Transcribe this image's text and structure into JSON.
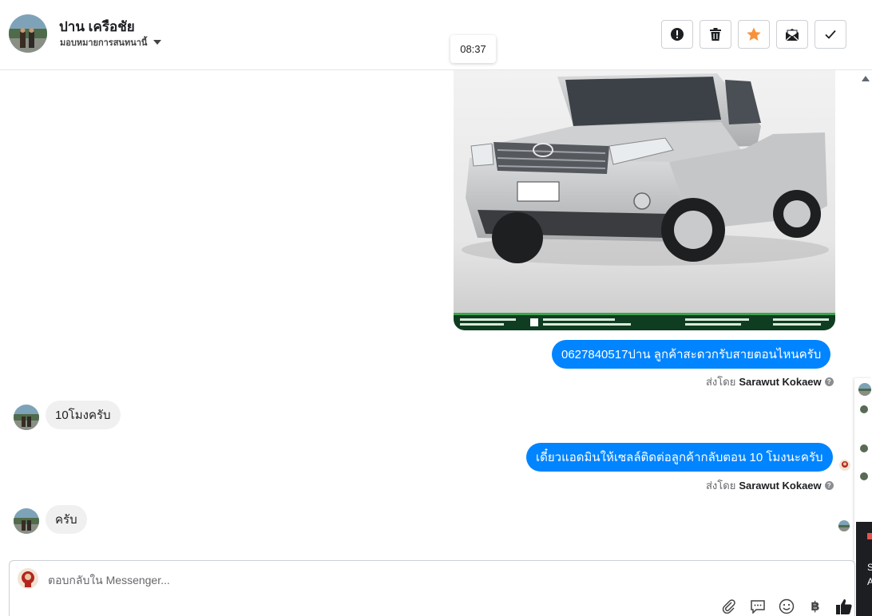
{
  "header": {
    "contact_name": "ปาน เครือชัย",
    "assign_label": "มอบหมายการสนทนานี้",
    "toolbar": {
      "spam": "alert-icon",
      "delete": "trash-icon",
      "star": "star-icon",
      "mark_unread": "envelope-icon",
      "done": "check-icon"
    },
    "colors": {
      "star": "#f7923b"
    }
  },
  "tooltip": {
    "time": "08:37"
  },
  "messages": [
    {
      "direction": "out",
      "type": "image",
      "image_label": "Toyota Hilux Vigo pickup (silver)"
    },
    {
      "direction": "out",
      "type": "text",
      "text": "0627840517ปาน  ลูกค้าสะดวกรับสายตอนไหนครับ",
      "sent_by_prefix": "ส่งโดย",
      "sent_by": "Sarawut Kokaew"
    },
    {
      "direction": "in",
      "type": "text",
      "text": "10โมงครับ"
    },
    {
      "direction": "out",
      "type": "text",
      "text": "เดี๋ยวแอดมินให้เซลล์ติดต่อลูกค้ากลับตอน 10 โมงนะครับ",
      "sent_by_prefix": "ส่งโดย",
      "sent_by": "Sarawut Kokaew"
    },
    {
      "direction": "in",
      "type": "text",
      "text": "ครับ"
    }
  ],
  "composer": {
    "placeholder": "ตอบกลับใน Messenger...",
    "value": "",
    "tools": [
      "paperclip-icon",
      "chat-bubble-icon",
      "emoji-icon",
      "baht-icon",
      "thumbs-up-icon"
    ],
    "baht_symbol": "฿"
  },
  "edge_panel": {
    "line1": "S",
    "line2": "A"
  },
  "colors": {
    "outgoing_bubble": "#0084ff",
    "incoming_bubble": "#f0f0f0"
  }
}
